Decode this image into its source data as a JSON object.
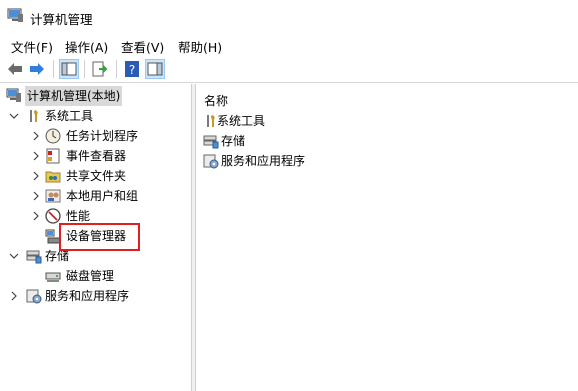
{
  "window": {
    "title": "计算机管理"
  },
  "menu": [
    "文件(F)",
    "操作(A)",
    "查看(V)",
    "帮助(H)"
  ],
  "tree": {
    "root": "计算机管理(本地)",
    "system_tools": "系统工具",
    "task_scheduler": "任务计划程序",
    "event_viewer": "事件查看器",
    "shared_folders": "共享文件夹",
    "local_users": "本地用户和组",
    "performance": "性能",
    "device_manager": "设备管理器",
    "storage": "存储",
    "disk_management": "磁盘管理",
    "services_apps": "服务和应用程序"
  },
  "list": {
    "header": "名称",
    "items": [
      "系统工具",
      "存储",
      "服务和应用程序"
    ]
  },
  "colors": {
    "highlight_border": "#e02020",
    "selection_bg": "#d9d9d9",
    "toolbar_pressed": "#cce4f7"
  },
  "icons": [
    "computer-icon",
    "back-arrow-icon",
    "forward-arrow-icon",
    "console-tree-icon",
    "export-icon",
    "help-icon",
    "properties-icon",
    "tools-icon",
    "clock-icon",
    "event-icon",
    "shared-folder-icon",
    "users-icon",
    "performance-icon",
    "device-manager-icon",
    "storage-icon",
    "disk-icon",
    "services-icon"
  ]
}
